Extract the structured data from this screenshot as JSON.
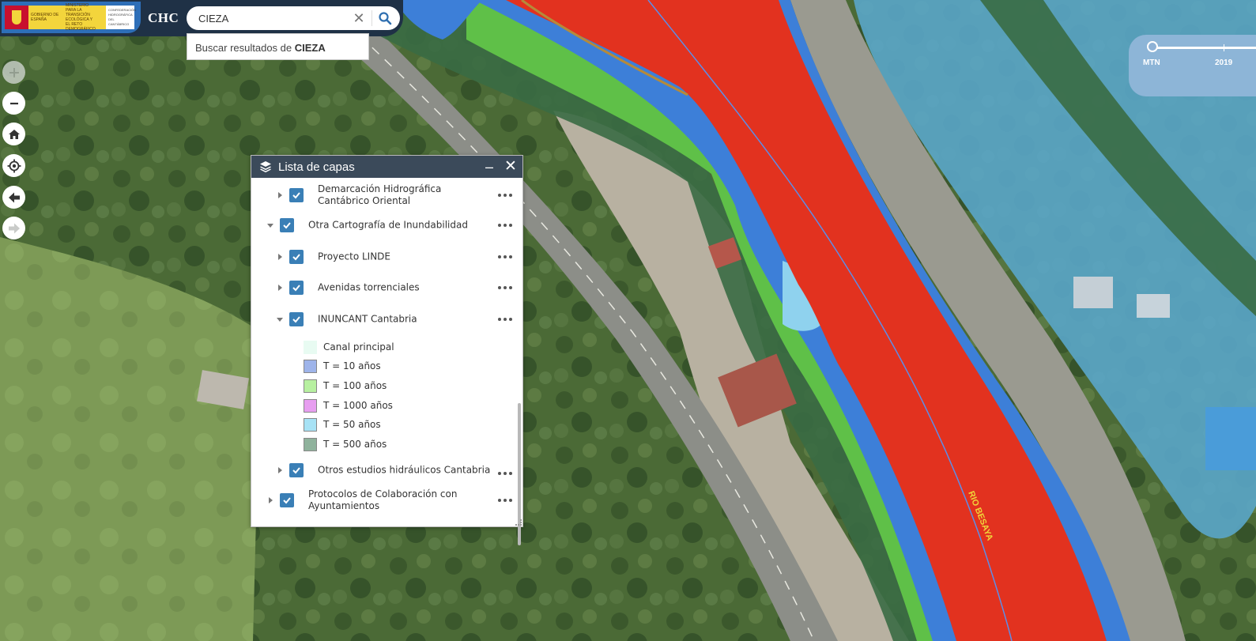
{
  "header": {
    "app_title": "CHC",
    "logo_lines": [
      "GOBIERNO DE ESPAÑA",
      "MINISTERIO PARA LA TRANSICIÓN ECOLÓGICA Y EL RETO DEMOGRÁFICO",
      "CONFEDERACIÓN HIDROGRÁFICA DEL CANTÁBRICO"
    ]
  },
  "search": {
    "value": "CIEZA",
    "suggestion_prefix": "Buscar resultados de ",
    "suggestion_term": "CIEZA"
  },
  "toolbar": {
    "buttons": [
      "zoom-in-icon",
      "zoom-out-icon",
      "home-icon",
      "locate-icon",
      "back-arrow-icon",
      "forward-arrow-icon"
    ]
  },
  "time_slider": {
    "start_label": "MTN",
    "end_label": "2019",
    "position": 0.0
  },
  "panel": {
    "title": "Lista de capas",
    "layers": [
      {
        "label": "Demarcación Hidrográfica Cantábrico Oriental",
        "level": 1,
        "expanded": false,
        "checked": true
      },
      {
        "label": "Otra Cartografía de Inundabilidad",
        "level": 0,
        "expanded": true,
        "checked": true
      },
      {
        "label": "Proyecto LINDE",
        "level": 1,
        "expanded": false,
        "checked": true
      },
      {
        "label": "Avenidas torrenciales",
        "level": 1,
        "expanded": false,
        "checked": true
      },
      {
        "label": "INUNCANT Cantabria",
        "level": 1,
        "expanded": true,
        "checked": true
      },
      {
        "label": "Otros estudios hidráulicos Cantabria",
        "level": 1,
        "expanded": false,
        "checked": true
      },
      {
        "label": "Protocolos de Colaboración con Ayuntamientos",
        "level": 0,
        "expanded": false,
        "checked": true
      }
    ],
    "legend": [
      {
        "label": "Canal principal",
        "color": "#e8fbf2"
      },
      {
        "label": "T = 10 años",
        "color": "#9eb4ea"
      },
      {
        "label": "T = 100 años",
        "color": "#b7f0a0"
      },
      {
        "label": "T = 1000 años",
        "color": "#e79ef0"
      },
      {
        "label": "T = 50 años",
        "color": "#a7e2f5"
      },
      {
        "label": "T = 500 años",
        "color": "#8fb29c"
      }
    ]
  },
  "map": {
    "river_label": "RIO BESAYA",
    "colors": {
      "vegetation": "#4d6b3a",
      "river_zone": "#e2321f",
      "flood_blue": "#3d7fd8",
      "flood_green": "#5fc048",
      "flood_dark": "#3a6b44",
      "light_blue_zone": "#5aa6c9",
      "road": "#8c8e88"
    }
  }
}
